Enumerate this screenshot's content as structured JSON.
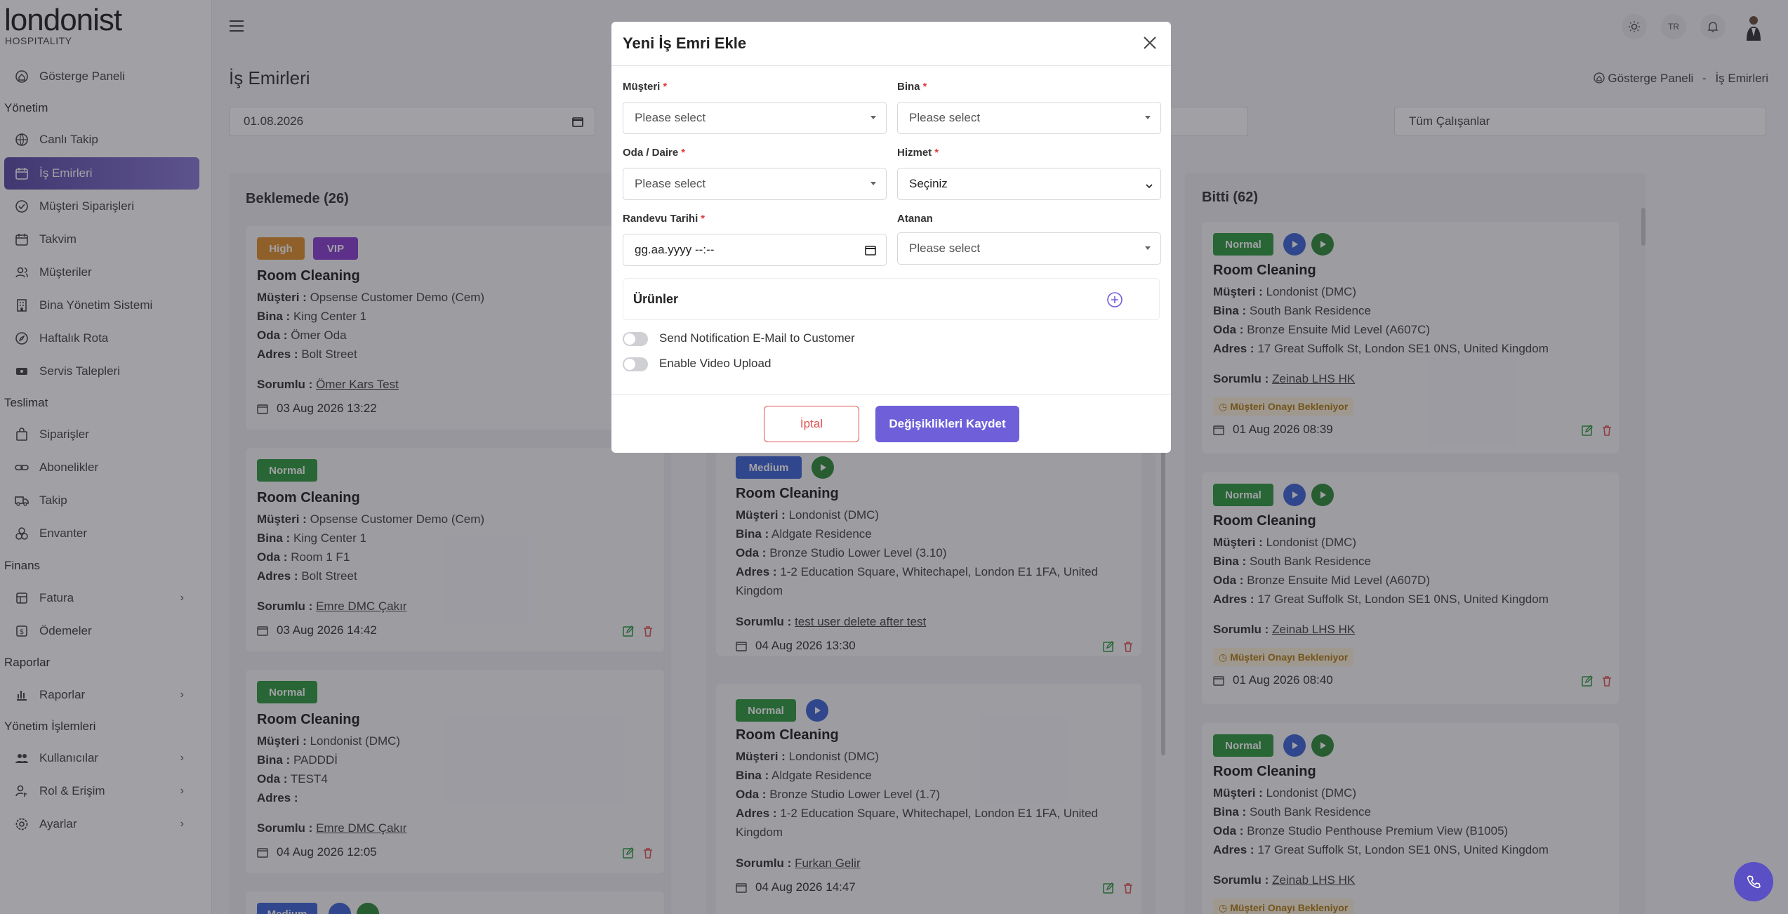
{
  "brand": {
    "logo": "londonist",
    "sub": "HOSPITALITY"
  },
  "header": {
    "lang": "TR"
  },
  "sidebar": {
    "dashboard": "Gösterge Paneli",
    "sec_manage": "Yönetim",
    "live": "Canlı Takip",
    "workorders": "İş Emirleri",
    "customer_orders": "Müşteri Siparişleri",
    "calendar": "Takvim",
    "customers": "Müşteriler",
    "bms": "Bina Yönetim Sistemi",
    "weekly": "Haftalık Rota",
    "service": "Servis Talepleri",
    "sec_delivery": "Teslimat",
    "orders": "Siparişler",
    "subs": "Abonelikler",
    "track": "Takip",
    "inventory": "Envanter",
    "sec_finance": "Finans",
    "invoice": "Fatura",
    "payments": "Ödemeler",
    "sec_reports": "Raporlar",
    "reports": "Raporlar",
    "sec_admin": "Yönetim İşlemleri",
    "users": "Kullanıcılar",
    "roles": "Rol & Erişim",
    "settings": "Ayarlar"
  },
  "page": {
    "title": "İş Emirleri",
    "crumb_home": "Gösterge Paneli",
    "crumb_sep": "-",
    "crumb_current": "İş Emirleri",
    "date_filter": "01.08.2026",
    "employee_filter": "Tüm Çalışanlar"
  },
  "col1": {
    "title": "Beklemede (26)",
    "cards": [
      {
        "b1": "High",
        "b2": "VIP",
        "title": "Room Cleaning",
        "k_customer": "Müşteri :",
        "customer": "Opsense Customer Demo (Cem)",
        "k_building": "Bina :",
        "building": "King Center 1",
        "k_room": "Oda :",
        "room": "Ömer Oda",
        "k_address": "Adres :",
        "address": "Bolt Street",
        "k_resp": "Sorumlu :",
        "resp": "Ömer Kars Test",
        "date": "03 Aug 2026 13:22"
      },
      {
        "b1": "Normal",
        "title": "Room Cleaning",
        "k_customer": "Müşteri :",
        "customer": "Opsense Customer Demo (Cem)",
        "k_building": "Bina :",
        "building": "King Center 1",
        "k_room": "Oda :",
        "room": "Room 1 F1",
        "k_address": "Adres :",
        "address": "Bolt Street",
        "k_resp": "Sorumlu :",
        "resp": "Emre DMC Çakır",
        "date": "03 Aug 2026 14:42"
      },
      {
        "b1": "Normal",
        "title": "Room Cleaning",
        "k_customer": "Müşteri :",
        "customer": "Londonist (DMC)",
        "k_building": "Bina :",
        "building": "PADDDİ",
        "k_room": "Oda :",
        "room": "TEST4",
        "k_address": "Adres :",
        "address": "",
        "k_resp": "Sorumlu :",
        "resp": "Emre DMC Çakır",
        "date": "04 Aug 2026 12:05"
      },
      {
        "b1": "Medium"
      }
    ]
  },
  "col2": {
    "cards": [
      {
        "b1": "Medium",
        "title": "Room Cleaning",
        "k_customer": "Müşteri :",
        "customer": "Londonist (DMC)",
        "k_building": "Bina :",
        "building": "Aldgate Residence",
        "k_room": "Oda :",
        "room": "Bronze Studio Lower Level (3.10)",
        "k_address": "Adres :",
        "address": "1-2 Education Square, Whitechapel, London E1 1FA, United",
        "address2": "Kingdom",
        "k_resp": "Sorumlu :",
        "resp": "test user delete after test",
        "date": "04 Aug 2026 13:30"
      },
      {
        "b1": "Normal",
        "title": "Room Cleaning",
        "k_customer": "Müşteri :",
        "customer": "Londonist (DMC)",
        "k_building": "Bina :",
        "building": "Aldgate Residence",
        "k_room": "Oda :",
        "room": "Bronze Studio Lower Level (1.7)",
        "k_address": "Adres :",
        "address": "1-2 Education Square, Whitechapel, London E1 1FA, United",
        "address2": "Kingdom",
        "k_resp": "Sorumlu :",
        "resp": "Furkan Gelir",
        "date": "04 Aug 2026 14:47"
      }
    ]
  },
  "col3": {
    "title": "Bitti (62)",
    "cards": [
      {
        "b1": "Normal",
        "title": "Room Cleaning",
        "k_customer": "Müşteri :",
        "customer": "Londonist (DMC)",
        "k_building": "Bina :",
        "building": "South Bank Residence",
        "k_room": "Oda :",
        "room": "Bronze Ensuite Mid Level (A607C)",
        "k_address": "Adres :",
        "address": "17 Great Suffolk St, London SE1 0NS, United Kingdom",
        "k_resp": "Sorumlu :",
        "resp": "Zeinab LHS HK",
        "approval": "Müşteri Onayı Bekleniyor",
        "date": "01 Aug 2026 08:39"
      },
      {
        "b1": "Normal",
        "title": "Room Cleaning",
        "k_customer": "Müşteri :",
        "customer": "Londonist (DMC)",
        "k_building": "Bina :",
        "building": "South Bank Residence",
        "k_room": "Oda :",
        "room": "Bronze Ensuite Mid Level (A607D)",
        "k_address": "Adres :",
        "address": "17 Great Suffolk St, London SE1 0NS, United Kingdom",
        "k_resp": "Sorumlu :",
        "resp": "Zeinab LHS HK",
        "approval": "Müşteri Onayı Bekleniyor",
        "date": "01 Aug 2026 08:40"
      },
      {
        "b1": "Normal",
        "title": "Room Cleaning",
        "k_customer": "Müşteri :",
        "customer": "Londonist (DMC)",
        "k_building": "Bina :",
        "building": "South Bank Residence",
        "k_room": "Oda :",
        "room": "Bronze Studio Penthouse Premium View (B1005)",
        "k_address": "Adres :",
        "address": "17 Great Suffolk St, London SE1 0NS, United Kingdom",
        "k_resp": "Sorumlu :",
        "resp": "Zeinab LHS HK",
        "approval": "Müşteri Onayı Bekleniyor"
      }
    ]
  },
  "modal": {
    "title": "Yeni İş Emri Ekle",
    "customer_label": "Müşteri",
    "building_label": "Bina",
    "room_label": "Oda / Daire",
    "service_label": "Hizmet",
    "date_label": "Randevu Tarihi",
    "assignee_label": "Atanan",
    "required_mark": "*",
    "placeholder": "Please select",
    "service_value": "Seçiniz",
    "date_value": "gg.aa.yyyy --:--",
    "products_label": "Ürünler",
    "notify_label": "Send Notification E-Mail to Customer",
    "video_label": "Enable Video Upload",
    "cancel": "İptal",
    "save": "Değişiklikleri Kaydet"
  },
  "colors": {
    "accent": "#6f5fd9",
    "high": "#e0902a",
    "vip": "#8a3fd1",
    "normal": "#2f9a3f",
    "medium": "#3f64d6",
    "danger": "#e05252"
  }
}
